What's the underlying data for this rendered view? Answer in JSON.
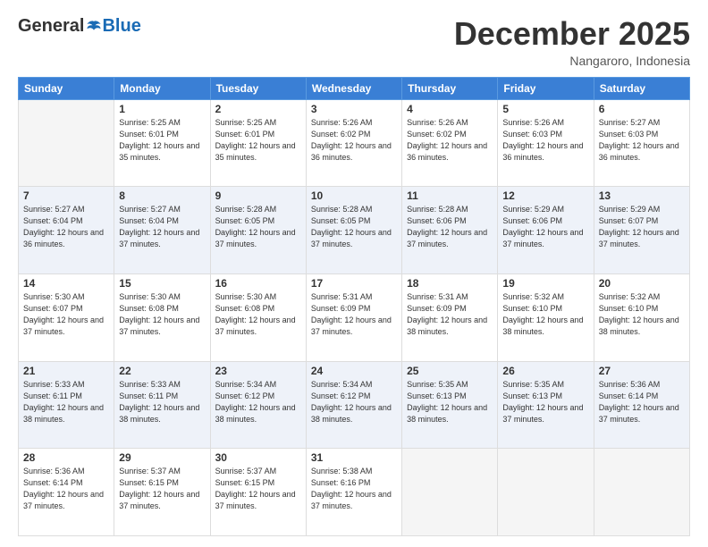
{
  "header": {
    "logo_general": "General",
    "logo_blue": "Blue",
    "month_year": "December 2025",
    "location": "Nangaroro, Indonesia"
  },
  "days_of_week": [
    "Sunday",
    "Monday",
    "Tuesday",
    "Wednesday",
    "Thursday",
    "Friday",
    "Saturday"
  ],
  "weeks": [
    [
      {
        "day": "",
        "sunrise": "",
        "sunset": "",
        "daylight": "",
        "empty": true
      },
      {
        "day": "1",
        "sunrise": "5:25 AM",
        "sunset": "6:01 PM",
        "daylight": "12 hours and 35 minutes."
      },
      {
        "day": "2",
        "sunrise": "5:25 AM",
        "sunset": "6:01 PM",
        "daylight": "12 hours and 35 minutes."
      },
      {
        "day": "3",
        "sunrise": "5:26 AM",
        "sunset": "6:02 PM",
        "daylight": "12 hours and 36 minutes."
      },
      {
        "day": "4",
        "sunrise": "5:26 AM",
        "sunset": "6:02 PM",
        "daylight": "12 hours and 36 minutes."
      },
      {
        "day": "5",
        "sunrise": "5:26 AM",
        "sunset": "6:03 PM",
        "daylight": "12 hours and 36 minutes."
      },
      {
        "day": "6",
        "sunrise": "5:27 AM",
        "sunset": "6:03 PM",
        "daylight": "12 hours and 36 minutes."
      }
    ],
    [
      {
        "day": "7",
        "sunrise": "5:27 AM",
        "sunset": "6:04 PM",
        "daylight": "12 hours and 36 minutes."
      },
      {
        "day": "8",
        "sunrise": "5:27 AM",
        "sunset": "6:04 PM",
        "daylight": "12 hours and 37 minutes."
      },
      {
        "day": "9",
        "sunrise": "5:28 AM",
        "sunset": "6:05 PM",
        "daylight": "12 hours and 37 minutes."
      },
      {
        "day": "10",
        "sunrise": "5:28 AM",
        "sunset": "6:05 PM",
        "daylight": "12 hours and 37 minutes."
      },
      {
        "day": "11",
        "sunrise": "5:28 AM",
        "sunset": "6:06 PM",
        "daylight": "12 hours and 37 minutes."
      },
      {
        "day": "12",
        "sunrise": "5:29 AM",
        "sunset": "6:06 PM",
        "daylight": "12 hours and 37 minutes."
      },
      {
        "day": "13",
        "sunrise": "5:29 AM",
        "sunset": "6:07 PM",
        "daylight": "12 hours and 37 minutes."
      }
    ],
    [
      {
        "day": "14",
        "sunrise": "5:30 AM",
        "sunset": "6:07 PM",
        "daylight": "12 hours and 37 minutes."
      },
      {
        "day": "15",
        "sunrise": "5:30 AM",
        "sunset": "6:08 PM",
        "daylight": "12 hours and 37 minutes."
      },
      {
        "day": "16",
        "sunrise": "5:30 AM",
        "sunset": "6:08 PM",
        "daylight": "12 hours and 37 minutes."
      },
      {
        "day": "17",
        "sunrise": "5:31 AM",
        "sunset": "6:09 PM",
        "daylight": "12 hours and 37 minutes."
      },
      {
        "day": "18",
        "sunrise": "5:31 AM",
        "sunset": "6:09 PM",
        "daylight": "12 hours and 38 minutes."
      },
      {
        "day": "19",
        "sunrise": "5:32 AM",
        "sunset": "6:10 PM",
        "daylight": "12 hours and 38 minutes."
      },
      {
        "day": "20",
        "sunrise": "5:32 AM",
        "sunset": "6:10 PM",
        "daylight": "12 hours and 38 minutes."
      }
    ],
    [
      {
        "day": "21",
        "sunrise": "5:33 AM",
        "sunset": "6:11 PM",
        "daylight": "12 hours and 38 minutes."
      },
      {
        "day": "22",
        "sunrise": "5:33 AM",
        "sunset": "6:11 PM",
        "daylight": "12 hours and 38 minutes."
      },
      {
        "day": "23",
        "sunrise": "5:34 AM",
        "sunset": "6:12 PM",
        "daylight": "12 hours and 38 minutes."
      },
      {
        "day": "24",
        "sunrise": "5:34 AM",
        "sunset": "6:12 PM",
        "daylight": "12 hours and 38 minutes."
      },
      {
        "day": "25",
        "sunrise": "5:35 AM",
        "sunset": "6:13 PM",
        "daylight": "12 hours and 38 minutes."
      },
      {
        "day": "26",
        "sunrise": "5:35 AM",
        "sunset": "6:13 PM",
        "daylight": "12 hours and 37 minutes."
      },
      {
        "day": "27",
        "sunrise": "5:36 AM",
        "sunset": "6:14 PM",
        "daylight": "12 hours and 37 minutes."
      }
    ],
    [
      {
        "day": "28",
        "sunrise": "5:36 AM",
        "sunset": "6:14 PM",
        "daylight": "12 hours and 37 minutes."
      },
      {
        "day": "29",
        "sunrise": "5:37 AM",
        "sunset": "6:15 PM",
        "daylight": "12 hours and 37 minutes."
      },
      {
        "day": "30",
        "sunrise": "5:37 AM",
        "sunset": "6:15 PM",
        "daylight": "12 hours and 37 minutes."
      },
      {
        "day": "31",
        "sunrise": "5:38 AM",
        "sunset": "6:16 PM",
        "daylight": "12 hours and 37 minutes."
      },
      {
        "day": "",
        "sunrise": "",
        "sunset": "",
        "daylight": "",
        "empty": true
      },
      {
        "day": "",
        "sunrise": "",
        "sunset": "",
        "daylight": "",
        "empty": true
      },
      {
        "day": "",
        "sunrise": "",
        "sunset": "",
        "daylight": "",
        "empty": true
      }
    ]
  ]
}
